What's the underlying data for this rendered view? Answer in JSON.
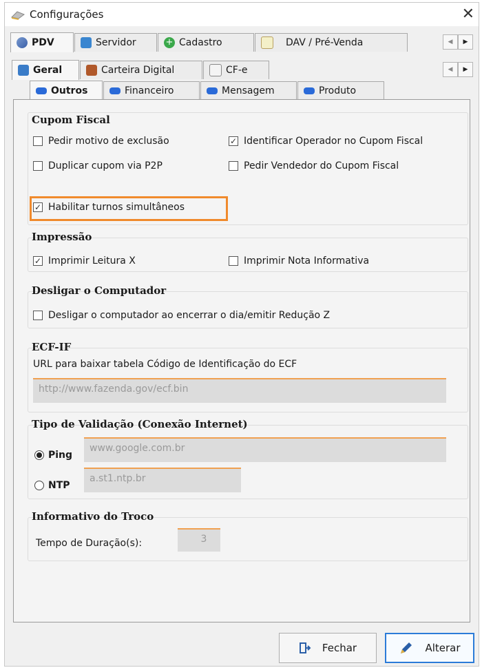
{
  "window": {
    "title": "Configurações",
    "close": "✕"
  },
  "tabs1": [
    {
      "label": "PDV",
      "active": true
    },
    {
      "label": "Servidor"
    },
    {
      "label": "Cadastro"
    },
    {
      "label": "DAV / Pré-Venda"
    }
  ],
  "tabs2": [
    {
      "label": "Geral",
      "active": true
    },
    {
      "label": "Carteira Digital"
    },
    {
      "label": "CF-e"
    }
  ],
  "tabs3": [
    {
      "label": "Outros",
      "active": true
    },
    {
      "label": "Financeiro"
    },
    {
      "label": "Mensagem"
    },
    {
      "label": "Produto"
    }
  ],
  "cupom": {
    "title": "Cupom Fiscal",
    "pedir_motivo": {
      "label": "Pedir motivo de exclusão",
      "checked": false
    },
    "identificar_operador": {
      "label": "Identificar Operador no Cupom Fiscal",
      "checked": true
    },
    "duplicar_cupom": {
      "label": "Duplicar cupom via P2P",
      "checked": false
    },
    "pedir_vendedor": {
      "label": "Pedir Vendedor do Cupom Fiscal",
      "checked": false
    },
    "habilitar_turnos": {
      "label": "Habilitar turnos simultâneos",
      "checked": true
    }
  },
  "impressao": {
    "title": "Impressão",
    "leitura_x": {
      "label": "Imprimir Leitura X",
      "checked": true
    },
    "nota_informativa": {
      "label": "Imprimir Nota Informativa",
      "checked": false
    }
  },
  "desligar": {
    "title": "Desligar o Computador",
    "option": {
      "label": "Desligar o computador ao encerrar o dia/emitir Redução Z",
      "checked": false
    }
  },
  "ecf": {
    "title": "ECF-IF",
    "url_label": "URL para baixar tabela Código de Identificação do ECF",
    "url_value": "http://www.fazenda.gov/ecf.bin"
  },
  "validacao": {
    "title": "Tipo de Validação (Conexão Internet)",
    "ping_label": "Ping",
    "ping_value": "www.google.com.br",
    "ntp_label": "NTP",
    "ntp_value": "a.st1.ntp.br",
    "selected": "Ping"
  },
  "troco": {
    "title": "Informativo do Troco",
    "tempo_label": "Tempo de Duração(s):",
    "tempo_value": "3"
  },
  "buttons": {
    "fechar": "Fechar",
    "alterar": "Alterar"
  },
  "colors": {
    "highlight": "#f08a2c",
    "primary_border": "#2b7bd8",
    "field_accent": "#f0a050"
  }
}
